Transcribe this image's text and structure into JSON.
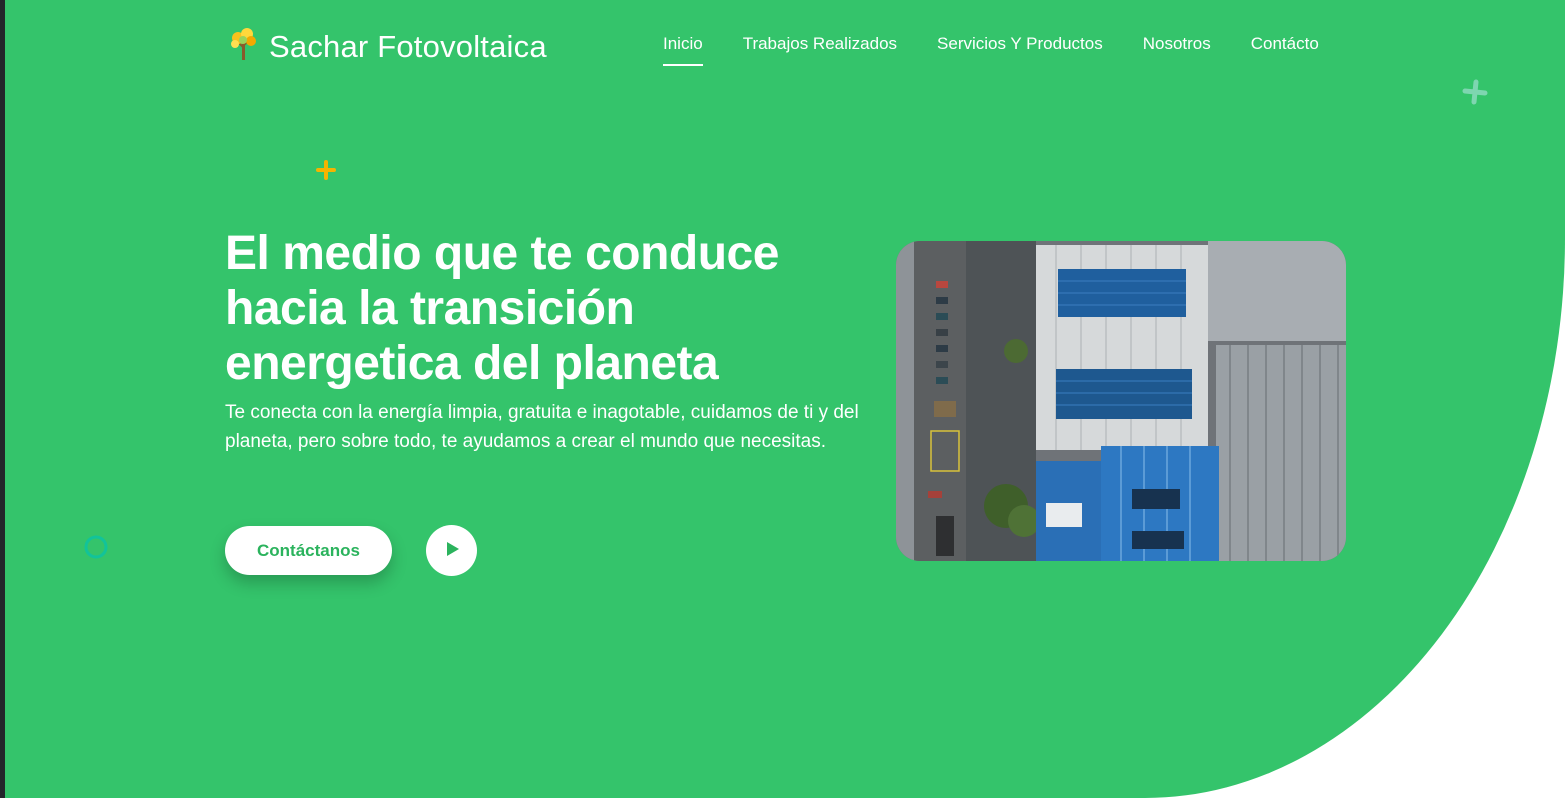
{
  "brand": {
    "name": "Sachar Fotovoltaica",
    "logo_icon": "tree-logo-icon"
  },
  "nav": {
    "items": [
      {
        "label": "Inicio",
        "active": true
      },
      {
        "label": "Trabajos Realizados",
        "active": false
      },
      {
        "label": "Servicios Y Productos",
        "active": false
      },
      {
        "label": "Nosotros",
        "active": false
      },
      {
        "label": "Contácto",
        "active": false
      }
    ]
  },
  "hero": {
    "headline": "El medio que te conduce hacia la transición energetica del planeta",
    "subtitle": "Te conecta con la energía limpia, gratuita e inagotable, cuidamos de ti y del planeta, pero sobre todo, te ayudamos a crear el mundo que necesitas.",
    "cta_label": "Contáctanos",
    "play_icon": "play-icon",
    "image": "aerial-rooftop-solar-panels"
  },
  "colors": {
    "hero_background": "#34c46b",
    "accent_text": "#2bb35d",
    "deco_yellow": "#f5b400",
    "deco_teal": "#7ed6b0",
    "deco_ring": "#12c39a"
  }
}
